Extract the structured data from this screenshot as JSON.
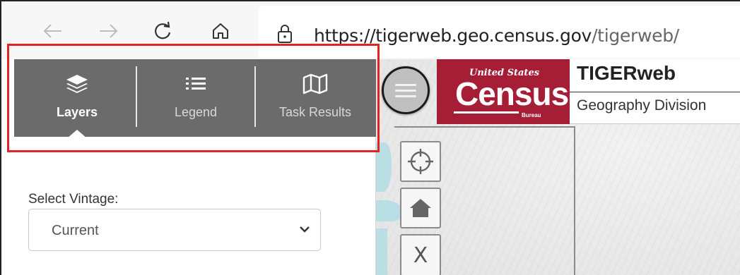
{
  "browser": {
    "url_host": "https://tigerweb.geo.census.gov",
    "url_path": "/tigerweb/",
    "back_icon": "arrow-left-icon",
    "forward_icon": "arrow-right-icon",
    "reload_icon": "reload-icon",
    "home_icon": "home-icon",
    "lock_icon": "lock-icon"
  },
  "panel": {
    "tabs": [
      {
        "label": "Layers",
        "icon": "layers-icon",
        "active": true
      },
      {
        "label": "Legend",
        "icon": "list-icon",
        "active": false
      },
      {
        "label": "Task Results",
        "icon": "map-icon",
        "active": false
      }
    ],
    "vintage_label": "Select Vintage:",
    "vintage_value": "Current"
  },
  "header": {
    "logo_small": "United States",
    "logo_big": "Census",
    "logo_bureau": "Bureau",
    "title": "TIGERweb",
    "subtitle": "Geography Division"
  },
  "map_tools": {
    "locate_icon": "crosshair-icon",
    "home_icon": "home-icon",
    "clear_label": "X"
  },
  "colors": {
    "panel_header": "#6b6b6b",
    "census_red": "#a61d36",
    "highlight": "#e02424"
  }
}
